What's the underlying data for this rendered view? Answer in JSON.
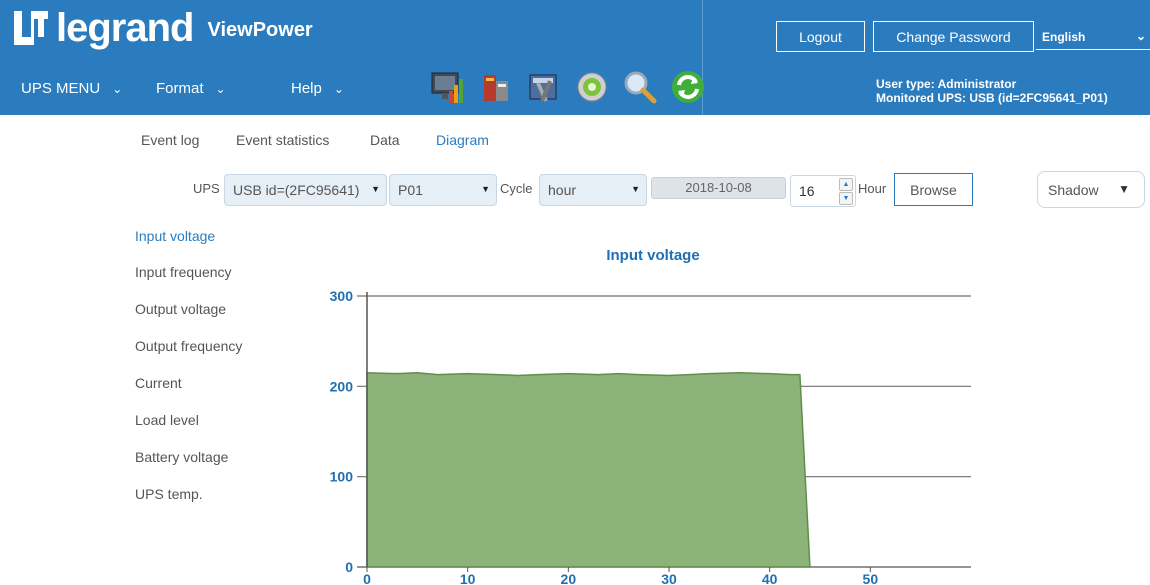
{
  "header": {
    "brand": "legrand",
    "product": "ViewPower",
    "logout_label": "Logout",
    "change_password_label": "Change Password",
    "language": "English",
    "menus": {
      "ups_menu": "UPS MENU",
      "format": "Format",
      "help": "Help"
    },
    "user_type": "User type: Administrator",
    "monitored_ups": "Monitored UPS: USB (id=2FC95641_P01)"
  },
  "tabs": [
    "Event log",
    "Event statistics",
    "Data",
    "Diagram"
  ],
  "filters": {
    "ups_label": "UPS",
    "ups_value": "USB id=(2FC95641)",
    "port_value": "P01",
    "cycle_label": "Cycle",
    "cycle_value": "hour",
    "date": "2018-10-08",
    "hour_value": "16",
    "hour_label": "Hour",
    "browse_label": "Browse",
    "style_value": "Shadow"
  },
  "side_list": [
    "Input voltage",
    "Input frequency",
    "Output voltage",
    "Output frequency",
    "Current",
    "Load level",
    "Battery voltage",
    "UPS temp."
  ],
  "colors": {
    "header_bg": "#2a7cbf",
    "accent": "#1f6fb4",
    "area_fill": "#8db27a",
    "area_stroke": "#5e8f4a"
  },
  "chart_data": {
    "type": "area",
    "title": "Input voltage",
    "xlabel": "",
    "ylabel": "",
    "xlim": [
      0,
      60
    ],
    "ylim": [
      0,
      300
    ],
    "xticks": [
      0,
      10,
      20,
      30,
      40,
      50
    ],
    "yticks": [
      0,
      100,
      200,
      300
    ],
    "grid": true,
    "series": [
      {
        "x": [
          0,
          3,
          5,
          7,
          10,
          13,
          15,
          17,
          20,
          23,
          25,
          27,
          30,
          32,
          34,
          37,
          40,
          42,
          43,
          44
        ],
        "values": [
          215,
          214,
          215,
          213,
          214,
          213,
          212,
          213,
          214,
          213,
          214,
          213,
          212,
          213,
          214,
          215,
          214,
          213,
          213,
          0
        ]
      }
    ]
  }
}
